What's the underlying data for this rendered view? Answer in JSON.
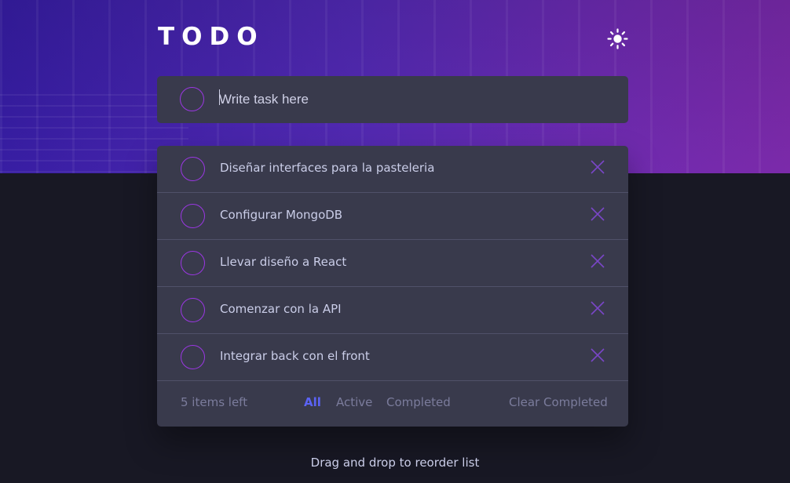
{
  "app": {
    "title": "TODO"
  },
  "new_task": {
    "placeholder": "Write task here"
  },
  "tasks": [
    {
      "label": "Diseñar interfaces para la pasteleria"
    },
    {
      "label": "Configurar MongoDB"
    },
    {
      "label": "Llevar diseño a React"
    },
    {
      "label": "Comenzar con la API"
    },
    {
      "label": "Integrar back con el front"
    }
  ],
  "footer": {
    "items_left": "5 items left",
    "filters": {
      "all": "All",
      "active": "Active",
      "completed": "Completed"
    },
    "active_filter": "All",
    "clear": "Clear Completed"
  },
  "hint": "Drag and drop to reorder list",
  "colors": {
    "accent": "#5b63f5",
    "check_border": "#9b37e3",
    "card": "#393a4c",
    "background": "#181824"
  },
  "icons": {
    "theme_toggle": "sun-icon",
    "delete": "close-icon"
  }
}
